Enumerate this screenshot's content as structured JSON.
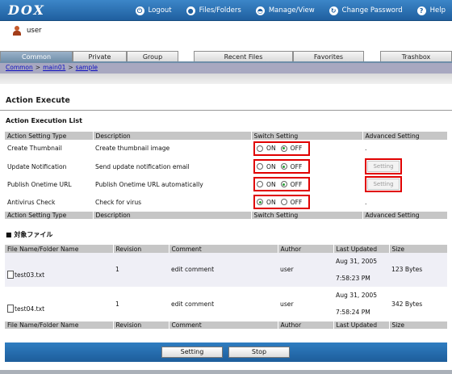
{
  "header": {
    "logo": "DOX",
    "nav": [
      {
        "label": "Logout",
        "icon": "logout-icon",
        "glyph": "⏻"
      },
      {
        "label": "Files/Folders",
        "icon": "folder-icon",
        "glyph": "●"
      },
      {
        "label": "Manage/View",
        "icon": "manage-icon",
        "glyph": "◓"
      },
      {
        "label": "Change Password",
        "icon": "refresh-icon",
        "glyph": "↻"
      },
      {
        "label": "Help",
        "icon": "help-icon",
        "glyph": "?"
      }
    ]
  },
  "user": {
    "name": "user"
  },
  "tabs": [
    "Common",
    "Private",
    "Group",
    "Recent Files",
    "Favorites",
    "Trashbox"
  ],
  "breadcrumb": [
    "Common",
    "main01",
    "sample"
  ],
  "page_title": "Action Execute",
  "action_list": {
    "title": "Action Execution List",
    "headers": [
      "Action Setting Type",
      "Description",
      "Switch Setting",
      "Advanced Setting"
    ],
    "rows": [
      {
        "type": "Create Thumbnail",
        "description": "Create thumbnail image",
        "on": "ON",
        "off": "OFF",
        "selected": "OFF",
        "advanced": "."
      },
      {
        "type": "Update Notification",
        "description": "Send update notification email",
        "on": "ON",
        "off": "OFF",
        "selected": "OFF",
        "advanced": "Setting"
      },
      {
        "type": "Publish Onetime URL",
        "description": "Publish Onetime URL automatically",
        "on": "ON",
        "off": "OFF",
        "selected": "OFF",
        "advanced": "Setting"
      },
      {
        "type": "Antivirus Check",
        "description": "Check for virus",
        "on": "ON",
        "off": "OFF",
        "selected": "ON",
        "advanced": "."
      }
    ]
  },
  "files": {
    "title": "■ 対象ファイル",
    "headers": [
      "File Name/Folder Name",
      "Revision",
      "Comment",
      "Author",
      "Last Updated",
      "Size"
    ],
    "rows": [
      {
        "name": "test03.txt",
        "revision": "1",
        "comment": "edit comment",
        "author": "user",
        "date": "Aug 31, 2005",
        "time": "7:58:23 PM",
        "size": "123 Bytes"
      },
      {
        "name": "test04.txt",
        "revision": "1",
        "comment": "edit comment",
        "author": "user",
        "date": "Aug 31, 2005",
        "time": "7:58:24 PM",
        "size": "342 Bytes"
      }
    ]
  },
  "buttons": {
    "setting": "Setting",
    "stop": "Stop"
  },
  "colors": {
    "header_blue": "#1f5f9f",
    "highlight_red": "#e00000",
    "radio_green": "#2a9d3a"
  }
}
